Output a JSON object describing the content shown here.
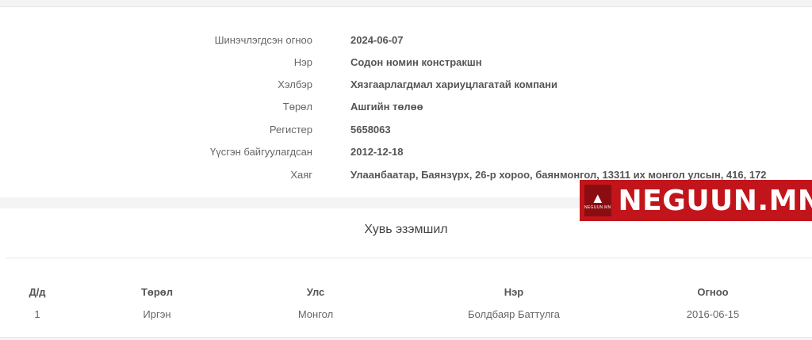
{
  "info": [
    {
      "label": "Шинэчлэгдсэн огноо",
      "value": "2024-06-07"
    },
    {
      "label": "Нэр",
      "value": "Содон номин констракшн"
    },
    {
      "label": "Хэлбэр",
      "value": "Хязгаарлагдмал хариуцлагатай компани"
    },
    {
      "label": "Төрөл",
      "value": "Ашгийн төлөө"
    },
    {
      "label": "Регистер",
      "value": "5658063"
    },
    {
      "label": "Үүсгэн байгуулагдсан",
      "value": "2012-12-18"
    },
    {
      "label": "Хаяг",
      "value": "Улаанбаатар, Баянзүрх, 26-р хороо, баянмонгол, 13311 их монгол улсын, 416, 172"
    }
  ],
  "ownership": {
    "title": "Хувь эзэмшил",
    "headers": [
      "Д/д",
      "Төрөл",
      "Улс",
      "Нэр",
      "Огноо"
    ],
    "rows": [
      [
        "1",
        "Иргэн",
        "Монгол",
        "Болдбаяр Баттулга",
        "2016-06-15"
      ]
    ]
  },
  "watermark": {
    "text": "NEGUUN.MN",
    "logo_small": "NEGUUN.MN",
    "color": "#c2151b"
  }
}
